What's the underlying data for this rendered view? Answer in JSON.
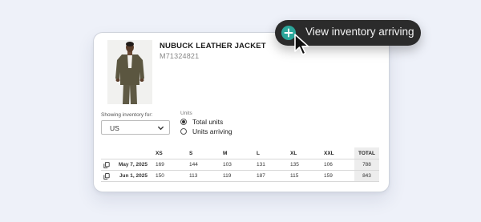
{
  "product": {
    "title": "NUBUCK LEATHER JACKET",
    "sku": "M71324821",
    "image": "model wearing olive jacket"
  },
  "filters": {
    "showing_label": "Showing inventory for:",
    "location_value": "US",
    "units_label": "Units",
    "options": [
      "Total units",
      "Units arriving"
    ],
    "selected": "Total units"
  },
  "table": {
    "headers": [
      "XS",
      "S",
      "M",
      "L",
      "XL",
      "XXL",
      "TOTAL"
    ],
    "rows": [
      {
        "date": "May 7, 2025",
        "values": [
          "169",
          "144",
          "103",
          "131",
          "135",
          "106"
        ],
        "total": "788"
      },
      {
        "date": "Jun 1, 2025",
        "values": [
          "150",
          "113",
          "119",
          "187",
          "115",
          "159"
        ],
        "total": "843"
      }
    ]
  },
  "action_button": {
    "label": "View inventory arriving",
    "icon": "plus-icon",
    "icon_color": "#2ba69a",
    "background": "#2b2b2b"
  }
}
